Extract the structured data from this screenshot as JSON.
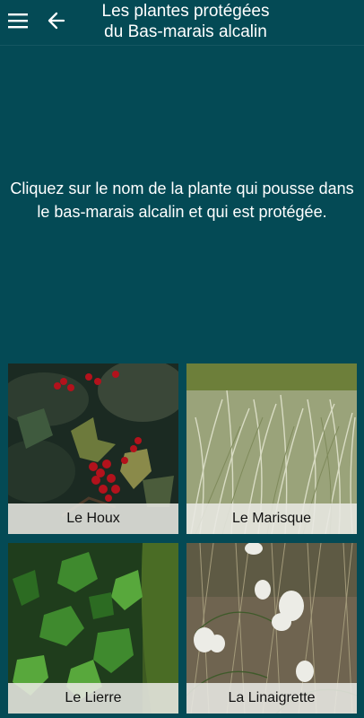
{
  "header": {
    "title_line1": "Les plantes protégées",
    "title_line2": "du Bas-marais alcalin",
    "menu_icon": "hamburger-menu-icon",
    "back_icon": "arrow-left-icon"
  },
  "instruction": "Cliquez sur le nom de la plante qui pousse dans le bas-marais alcalin et qui est protégée.",
  "plants": [
    {
      "label": "Le Houx"
    },
    {
      "label": "Le Marisque"
    },
    {
      "label": "Le Lierre"
    },
    {
      "label": "La Linaigrette"
    }
  ],
  "colors": {
    "background": "#044a55",
    "label_background": "#e8e8e2",
    "label_text": "#111111"
  }
}
